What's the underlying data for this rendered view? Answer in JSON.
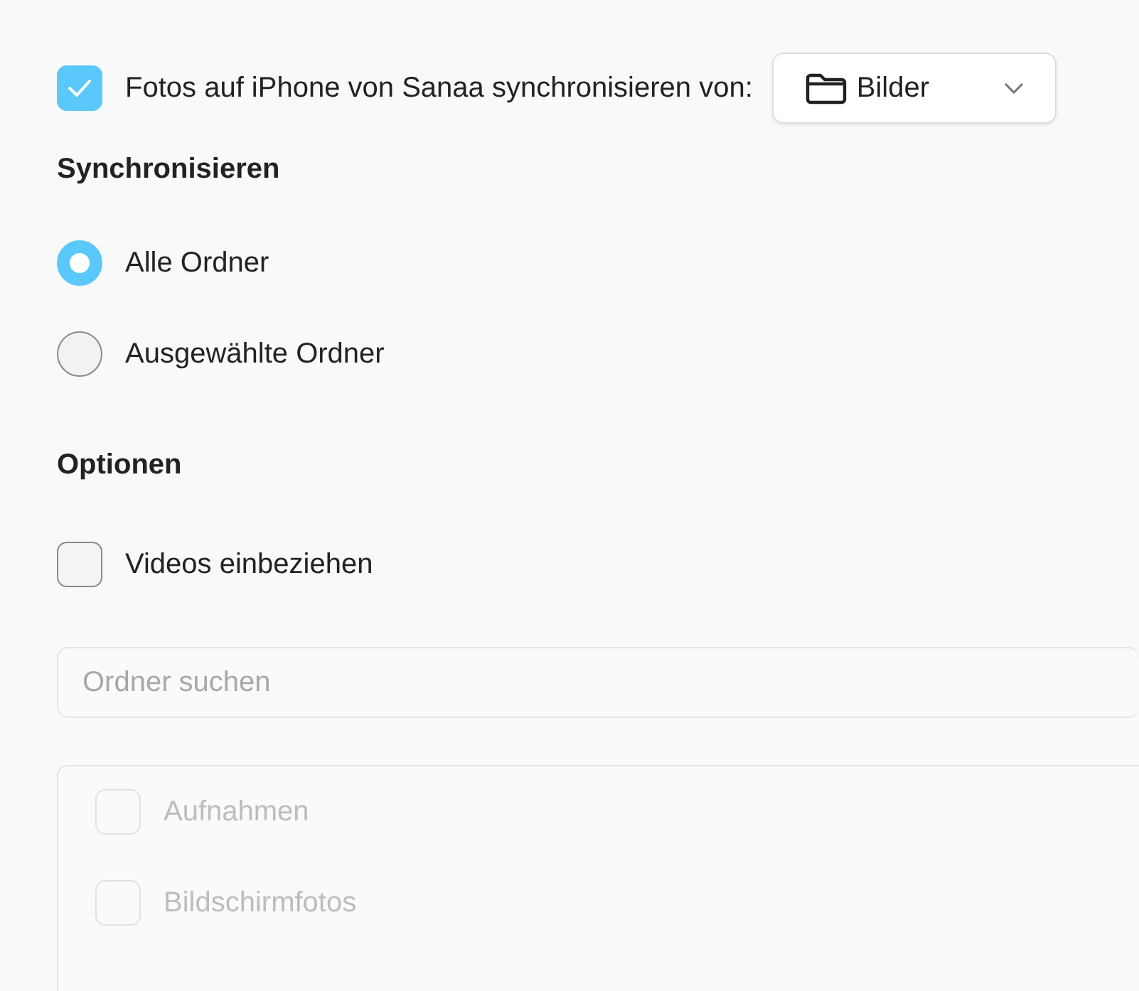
{
  "sync": {
    "checked": true,
    "label": "Fotos auf iPhone von Sanaa synchronisieren von:",
    "source": {
      "label": "Bilder"
    }
  },
  "sync_section": {
    "heading": "Synchronisieren",
    "options": [
      {
        "label": "Alle Ordner",
        "selected": true
      },
      {
        "label": "Ausgewählte Ordner",
        "selected": false
      }
    ]
  },
  "options_section": {
    "heading": "Optionen",
    "checkboxes": [
      {
        "label": "Videos einbeziehen",
        "checked": false
      }
    ]
  },
  "search": {
    "placeholder": "Ordner suchen"
  },
  "folders": {
    "disabled": true,
    "items": [
      {
        "label": "Aufnahmen",
        "checked": false
      },
      {
        "label": "Bildschirmfotos",
        "checked": false
      }
    ]
  }
}
